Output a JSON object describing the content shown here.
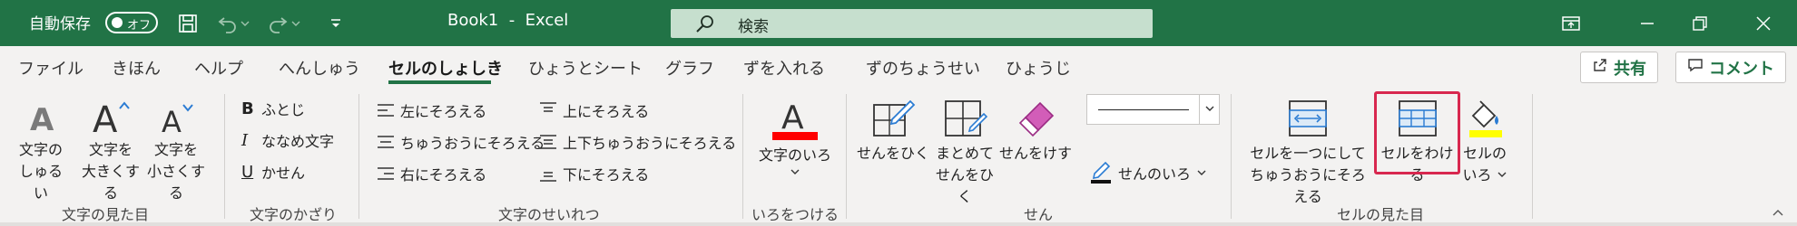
{
  "titlebar": {
    "autosave_label": "自動保存",
    "toggle_label": "オフ",
    "window_title": "Book1  -  Excel",
    "search_placeholder": "検索",
    "icons": [
      "save-icon",
      "undo-icon",
      "redo-icon",
      "customize-qat-icon",
      "ribbon-display-icon",
      "minimize-icon",
      "restore-icon",
      "close-icon"
    ]
  },
  "tabs": [
    "ファイル",
    "きほん",
    "ヘルプ",
    "へんしゅう",
    "セルのしょしき",
    "ひょうとシート",
    "グラフ",
    "ずを入れる",
    "ずのちょうせい",
    "ひょうじ"
  ],
  "active_tab": "セルのしょしき",
  "share": {
    "share_label": "共有",
    "comment_label": "コメント"
  },
  "groups": {
    "text_look": {
      "label": "文字の見た目",
      "buttons": [
        {
          "l1": "文字の",
          "l2": "しゅるい"
        },
        {
          "l1": "文字を",
          "l2": "大きくする"
        },
        {
          "l1": "文字を",
          "l2": "小さくする"
        }
      ]
    },
    "decoration": {
      "label": "文字のかざり",
      "items": [
        "ふとじ",
        "ななめ文字",
        "かせん"
      ]
    },
    "alignment": {
      "label": "文字のせいれつ",
      "left_col": [
        "左にそろえる",
        "ちゅうおうにそろえる",
        "右にそろえる"
      ],
      "right_col": [
        "上にそろえる",
        "上下ちゅうおうにそろえる",
        "下にそろえる"
      ]
    },
    "color": {
      "label": "いろをつける",
      "button": "文字のいろ",
      "accent": "#ff0000"
    },
    "lines": {
      "label": "せん",
      "buttons": [
        {
          "l1": "せんをひく",
          "l2": ""
        },
        {
          "l1": "まとめて",
          "l2": "せんをひく"
        },
        {
          "l1": "せんをけす",
          "l2": ""
        }
      ],
      "line_color": "せんのいろ"
    },
    "cell_look": {
      "label": "セルの見た目",
      "merge_center": {
        "l1": "セルを一つにして",
        "l2": "ちゅうおうにそろえる"
      },
      "split": "セルをわける",
      "fill": {
        "l1": "セルの",
        "l2": "いろ"
      },
      "fill_accent": "#ffff00"
    }
  },
  "colors": {
    "brand": "#217346",
    "highlight": "#d8284f",
    "ribbon_bg": "#f3f2f1"
  }
}
